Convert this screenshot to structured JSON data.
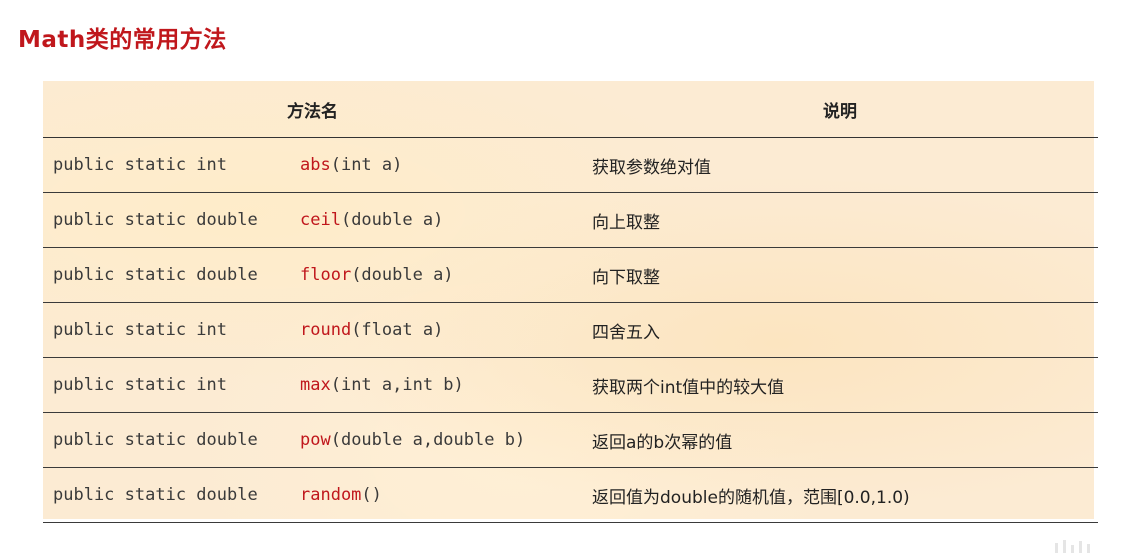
{
  "page": {
    "title": "Math类的常用方法"
  },
  "table": {
    "headers": {
      "method": "方法名",
      "description": "说明"
    },
    "rows": [
      {
        "modifiers": "public static int",
        "name": "abs",
        "params": "(int a)",
        "description": "获取参数绝对值"
      },
      {
        "modifiers": "public static double",
        "name": "ceil",
        "params": "(double a)",
        "description": "向上取整"
      },
      {
        "modifiers": "public static double",
        "name": "floor",
        "params": "(double a)",
        "description": "向下取整"
      },
      {
        "modifiers": "public static int",
        "name": "round",
        "params": "(float a)",
        "description": "四舍五入"
      },
      {
        "modifiers": "public static int",
        "name": "max",
        "params": "(int a,int b)",
        "description": "获取两个int值中的较大值"
      },
      {
        "modifiers": "public static double",
        "name": "pow",
        "params": "(double a,double b)",
        "description": "返回a的b次幂的值"
      },
      {
        "modifiers": "public static double",
        "name": "random",
        "params": "()",
        "description": "返回值为double的随机值，范围[0.0,1.0)"
      }
    ]
  },
  "colors": {
    "accent": "#c0171c",
    "table_background": "#fcebd3",
    "text": "#333333"
  }
}
